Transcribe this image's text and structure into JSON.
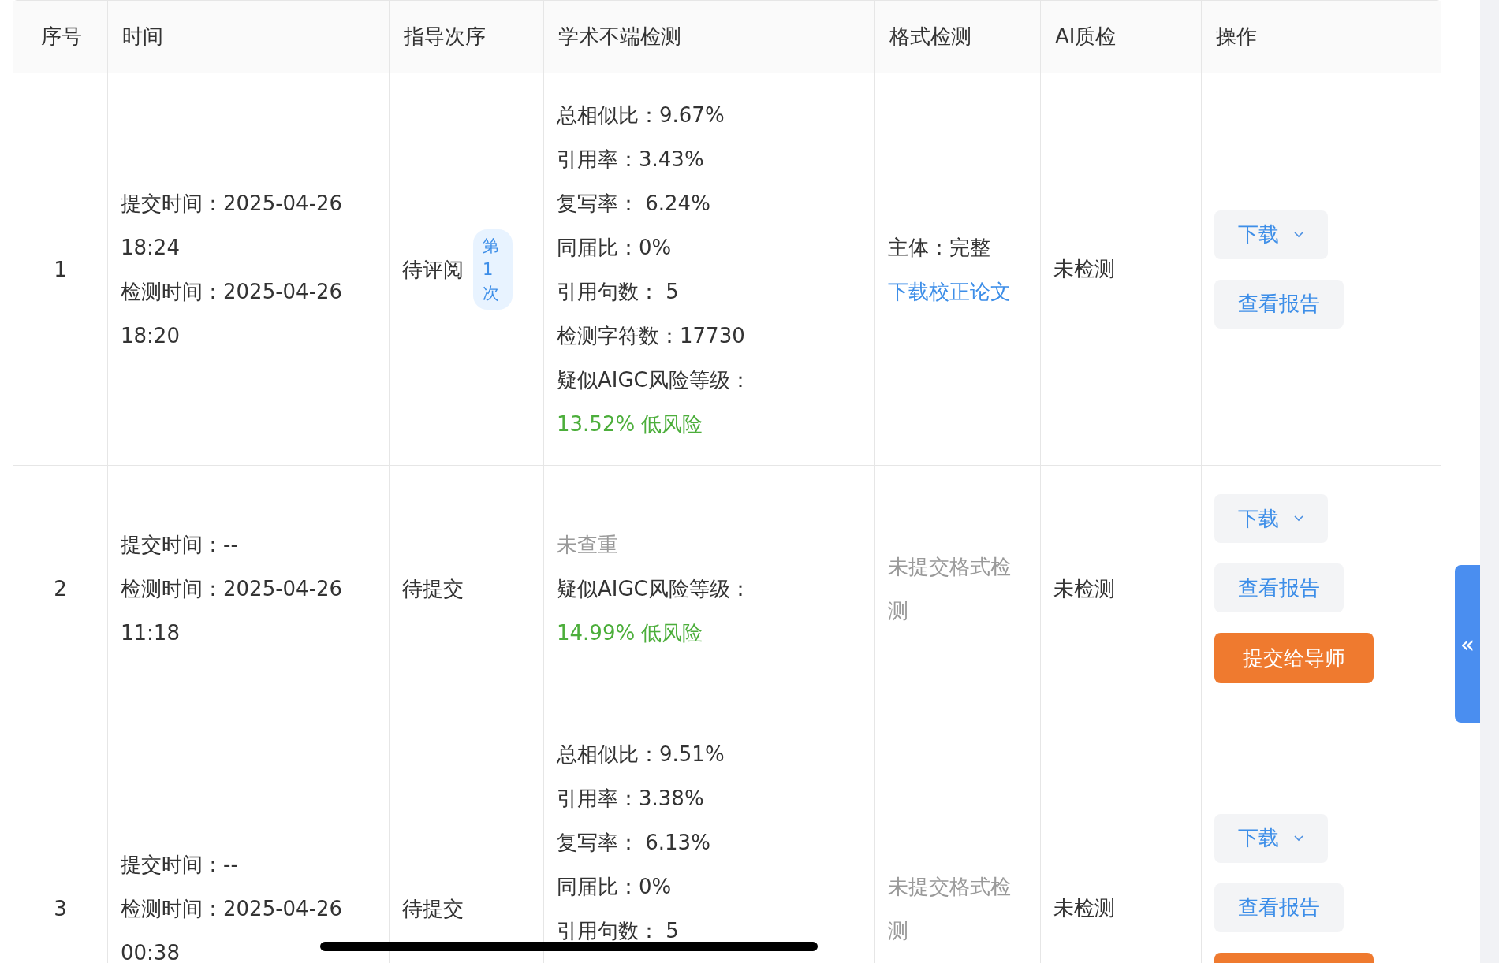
{
  "table": {
    "columns": [
      "序号",
      "时间",
      "指导次序",
      "学术不端检测",
      "格式检测",
      "AI质检",
      "操作"
    ],
    "rows": [
      {
        "index": "1",
        "times": [
          "提交时间：2025-04-26",
          "18:24",
          "检测时间：2025-04-26",
          "18:20"
        ],
        "status": "待评阅",
        "tag": "第1次",
        "plagiarism": [
          {
            "text": "总相似比：9.67%",
            "kind": "normal"
          },
          {
            "text": "引用率：3.43%",
            "kind": "normal"
          },
          {
            "text": "复写率： 6.24%",
            "kind": "normal"
          },
          {
            "text": "同届比：0%",
            "kind": "normal"
          },
          {
            "text": "引用句数： 5",
            "kind": "normal"
          },
          {
            "text": "检测字符数：17730",
            "kind": "normal"
          },
          {
            "text": "疑似AIGC风险等级：",
            "kind": "normal"
          },
          {
            "text": "13.52% 低风险",
            "kind": "good"
          }
        ],
        "format": [
          {
            "text": "主体：完整",
            "kind": "normal"
          },
          {
            "text": "下载校正论文",
            "kind": "link"
          }
        ],
        "ai": "未检测",
        "actions": [
          {
            "label": "下载",
            "kind": "dropdown"
          },
          {
            "label": "查看报告",
            "kind": "plain"
          }
        ]
      },
      {
        "index": "2",
        "times": [
          "提交时间：--",
          "检测时间：2025-04-26",
          "11:18"
        ],
        "status": "待提交",
        "plagiarism": [
          {
            "text": "未查重",
            "kind": "muted"
          },
          {
            "text": "疑似AIGC风险等级：",
            "kind": "normal"
          },
          {
            "text": "14.99% 低风险",
            "kind": "good"
          }
        ],
        "format": [
          {
            "text": "未提交格式检测",
            "kind": "muted"
          }
        ],
        "ai": "未检测",
        "actions": [
          {
            "label": "下载",
            "kind": "dropdown"
          },
          {
            "label": "查看报告",
            "kind": "plain"
          },
          {
            "label": "提交给导师",
            "kind": "primary"
          }
        ]
      },
      {
        "index": "3",
        "times": [
          "提交时间：--",
          "检测时间：2025-04-26",
          "00:38"
        ],
        "status": "待提交",
        "plagiarism": [
          {
            "text": "总相似比：9.51%",
            "kind": "normal"
          },
          {
            "text": "引用率：3.38%",
            "kind": "normal"
          },
          {
            "text": "复写率： 6.13%",
            "kind": "normal"
          },
          {
            "text": "同届比：0%",
            "kind": "normal"
          },
          {
            "text": "引用句数： 5",
            "kind": "normal"
          }
        ],
        "format": [
          {
            "text": "未提交格式检测",
            "kind": "muted"
          }
        ],
        "ai": "未检测",
        "actions": [
          {
            "label": "下载",
            "kind": "dropdown"
          },
          {
            "label": "查看报告",
            "kind": "plain"
          },
          {
            "kind": "primary"
          }
        ]
      }
    ]
  },
  "side_tab": {
    "label": "«"
  }
}
